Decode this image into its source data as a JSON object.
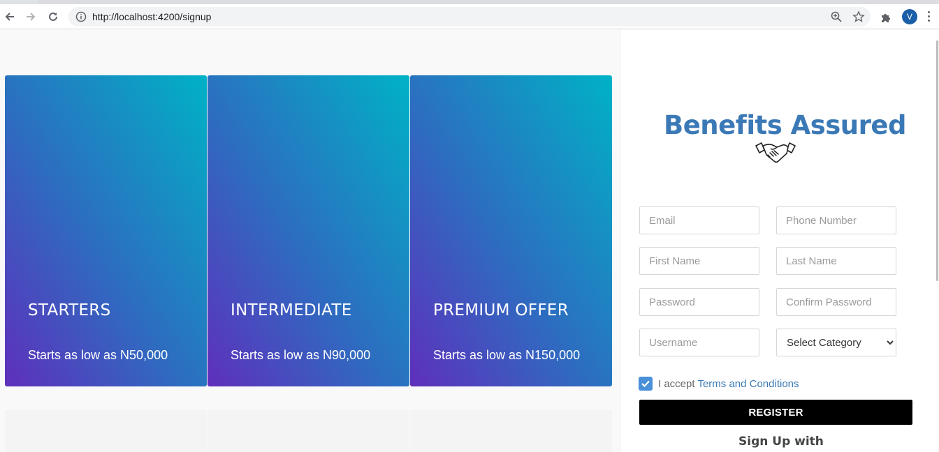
{
  "browser": {
    "url": "http://localhost:4200/signup",
    "avatar_letter": "V"
  },
  "plans": [
    {
      "title": "STARTERS",
      "price": "Starts as low as N50,000"
    },
    {
      "title": "INTERMEDIATE",
      "price": "Starts as low as N90,000"
    },
    {
      "title": "PREMIUM OFFER",
      "price": "Starts as low as N150,000"
    }
  ],
  "signup": {
    "brand": "Benefits Assured",
    "fields": {
      "email": "Email",
      "phone": "Phone Number",
      "first_name": "First Name",
      "last_name": "Last Name",
      "password": "Password",
      "confirm_password": "Confirm Password",
      "username": "Username",
      "category": "Select Category"
    },
    "accept_prefix": "I accept ",
    "terms_link": "Terms and Conditions",
    "terms_checked": true,
    "register_label": "REGISTER",
    "signup_with": "Sign Up with"
  },
  "colors": {
    "accent": "#3a79b6",
    "card_gradient_start": "#5f2fbc",
    "card_gradient_end": "#00b2c6",
    "register_bg": "#000000"
  }
}
